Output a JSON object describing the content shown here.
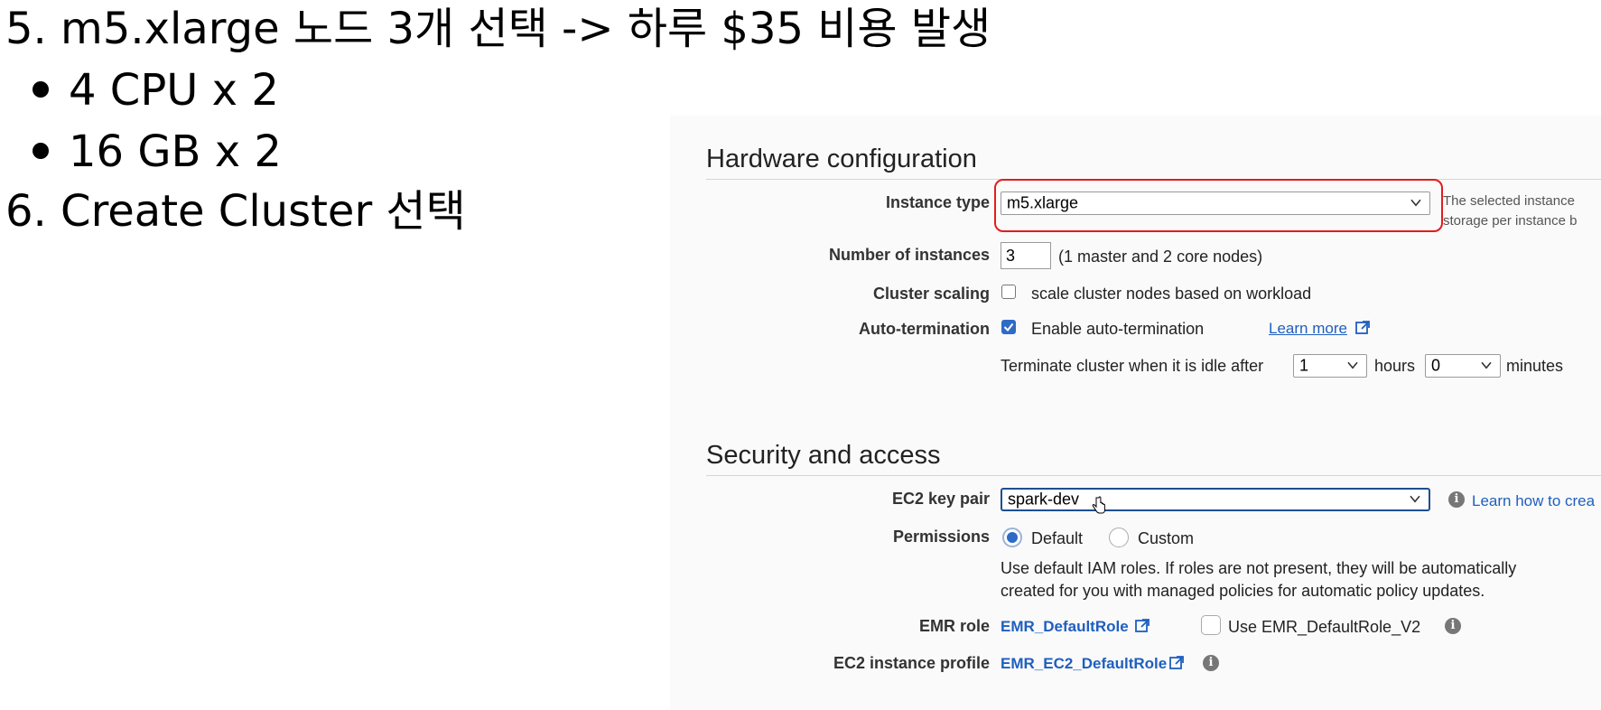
{
  "slide": {
    "step5": "5. m5.xlarge 노드 3개 선택 -> 하루 $35 비용 발생",
    "bullet1": "4 CPU x 2",
    "bullet2": "16 GB x 2",
    "step6": "6. Create Cluster 선택"
  },
  "hardware": {
    "title": "Hardware configuration",
    "instance_type_label": "Instance type",
    "instance_type_value": "m5.xlarge",
    "instance_note_1": "The selected instance",
    "instance_note_2": "storage per instance b",
    "num_instances_label": "Number of instances",
    "num_instances_value": "3",
    "num_instances_note": "(1 master and 2 core nodes)",
    "scaling_label": "Cluster scaling",
    "scaling_text": "scale cluster nodes based on workload",
    "scaling_checked": false,
    "autoterm_label": "Auto-termination",
    "autoterm_text": "Enable auto-termination",
    "autoterm_checked": true,
    "learn_more": "Learn more",
    "idle_text": "Terminate cluster when it is idle after",
    "hours_value": "1",
    "hours_text": "hours",
    "minutes_value": "0",
    "minutes_text": "minutes"
  },
  "security": {
    "title": "Security and access",
    "keypair_label": "EC2 key pair",
    "keypair_value": "spark-dev",
    "learn_how": "Learn how to crea",
    "permissions_label": "Permissions",
    "perm_default": "Default",
    "perm_custom": "Custom",
    "perm_desc_1": "Use default IAM roles. If roles are not present, they will be automatically",
    "perm_desc_2": "created for you with managed policies for automatic policy updates.",
    "emr_role_label": "EMR role",
    "emr_role_value": "EMR_DefaultRole",
    "emr_v2_text": "Use EMR_DefaultRole_V2",
    "ec2_profile_label": "EC2 instance profile",
    "ec2_profile_value": "EMR_EC2_DefaultRole"
  },
  "colors": {
    "highlight": "#e21d1d",
    "link": "#1f5fbf",
    "accent": "#2f6bc5"
  },
  "icons": [
    "chevron-down-icon",
    "external-link-icon",
    "info-icon",
    "hand-cursor-icon"
  ]
}
